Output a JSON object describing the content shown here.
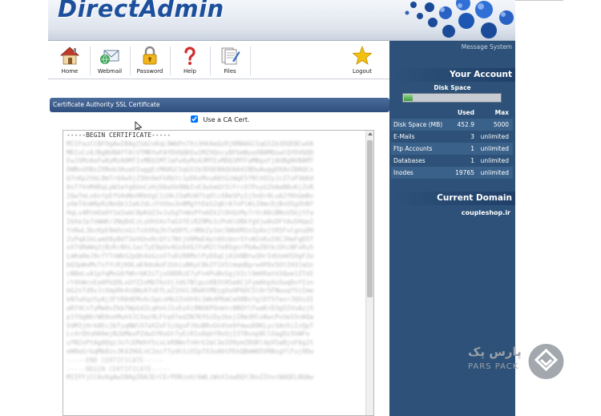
{
  "brand": {
    "logo_text": "DirectAdmin"
  },
  "toolbar": {
    "items": [
      {
        "label": "Home",
        "icon": "home-icon"
      },
      {
        "label": "Webmail",
        "icon": "webmail-icon"
      },
      {
        "label": "Password",
        "icon": "lock-icon"
      },
      {
        "label": "Help",
        "icon": "help-icon"
      },
      {
        "label": "Files",
        "icon": "files-icon"
      },
      {
        "label": "Logout",
        "icon": "star-icon"
      }
    ]
  },
  "certificate": {
    "section_title": "Certificate Authority SSL Certificate",
    "use_ca_label": "Use a CA Cert.",
    "use_ca_checked": true,
    "begin_line": "-----BEGIN CERTIFICATE-----",
    "end_line": "-----END CERTIFICATE-----",
    "begin_line_2": "-----BEGIN CERTIFICATE-----"
  },
  "panel": {
    "message_system": "Message System",
    "your_account": "Your Account",
    "disk_space_label": "Disk Space",
    "disk_usage_fraction": 0.09,
    "headers": {
      "used": "Used",
      "max": "Max"
    },
    "stats": [
      {
        "name": "Disk Space (MB)",
        "used": "452.9",
        "max": "5000"
      },
      {
        "name": "E-Mails",
        "used": "3",
        "max": "unlimited"
      },
      {
        "name": "Ftp Accounts",
        "used": "1",
        "max": "unlimited"
      },
      {
        "name": "Databases",
        "used": "1",
        "max": "unlimited"
      },
      {
        "name": "Inodes",
        "used": "19765",
        "max": "unlimited"
      }
    ],
    "current_domain_title": "Current Domain",
    "current_domain": "coupleshop.ir"
  },
  "watermark": {
    "fa": "پارس پک",
    "en": "PARS PACK"
  },
  "colors": {
    "panel": "#2d5178",
    "brand": "#1c4f9c",
    "bar_start": "#4b6c9a"
  }
}
